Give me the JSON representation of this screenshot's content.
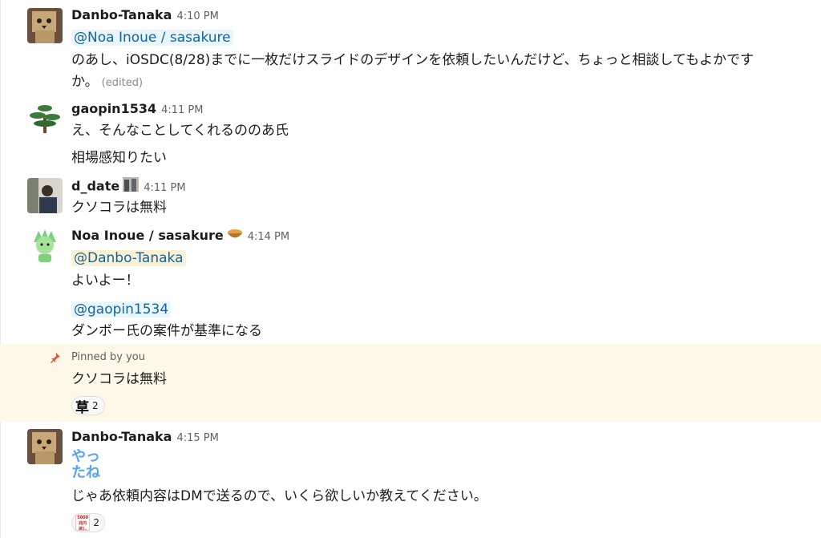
{
  "messages": [
    {
      "author": "Danbo-Tanaka",
      "time": "4:10 PM",
      "mention": "@Noa Inoue / sasakure",
      "text_line1": "のあし、iOSDC(8/28)までに一枚だけスライドのデザインを依頼したいんだけど、ちょっと相談してもよかです",
      "text_line2": "か。",
      "edited": "(edited)"
    },
    {
      "author": "gaopin1534",
      "time": "4:11 PM",
      "text_line1": "え、そんなことしてくれるののあ氏",
      "text_line2": "相場感知りたい"
    },
    {
      "author": "d_date",
      "time": "4:11 PM",
      "text_line1": "クソコラは無料"
    },
    {
      "author": "Noa Inoue / sasakure",
      "time": "4:14 PM",
      "mention1": "@Danbo-Tanaka",
      "text_line1": "よいよー！",
      "mention2": "@gaopin1534",
      "text_line2": "ダンボー氏の案件が基準になる"
    },
    {
      "pinned_label": "Pinned by you",
      "text_line1": "クソコラは無料",
      "reaction_emoji": "草",
      "reaction_count": "2"
    },
    {
      "author": "Danbo-Tanaka",
      "time": "4:15 PM",
      "custom_emoji_text": "やっ\nたね",
      "text_line1": "じゃあ依頼内容はDMで送るので、いくら欲しいか教えてください。",
      "reaction_emoji_text": "5000兆円 欲しい！",
      "reaction_count": "2"
    }
  ],
  "colors": {
    "mention_text": "#1264a3",
    "mention_bg": "#e8f5fa",
    "mention_self_bg": "#fcf0d3",
    "pinned_bg": "#fdf8e7",
    "pin_icon": "#e0553e"
  },
  "icons": {
    "pin": "pin-icon",
    "status_d_date": "photo-status-icon",
    "status_noa": "bowl-status-icon"
  }
}
